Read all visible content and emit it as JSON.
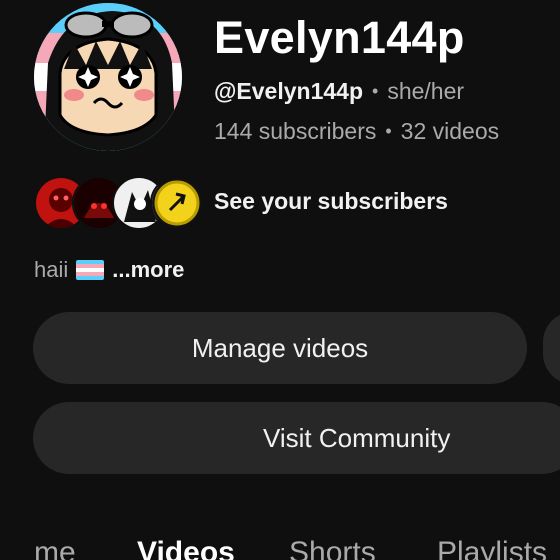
{
  "channel": {
    "name": "Evelyn144p",
    "handle": "@Evelyn144p",
    "pronouns": "she/her",
    "subscribers": "144 subscribers",
    "videos": "32 videos",
    "separator": "•"
  },
  "subscribers_row": {
    "label": "See your subscribers",
    "avatar_colors": [
      "#c0120f",
      "#1a0000",
      "#f0f0f0",
      "#f2d21a"
    ]
  },
  "description": {
    "text": "haii",
    "flag_icon": "trans-flag-icon",
    "more_label": "...more"
  },
  "buttons": {
    "manage_videos": "Manage videos",
    "visit_community": "Visit Community"
  },
  "tabs": [
    {
      "label": "Home",
      "visible_label": "me"
    },
    {
      "label": "Videos",
      "visible_label": "Videos",
      "active": true
    },
    {
      "label": "Shorts",
      "visible_label": "Shorts"
    },
    {
      "label": "Playlists",
      "visible_label": "Playlists"
    }
  ],
  "colors": {
    "background": "#0f0f0f",
    "button_bg": "#272727",
    "text_primary": "#f1f1f1",
    "text_secondary": "#aaaaaa",
    "trans_blue": "#5bcefa",
    "trans_pink": "#f5a9b8"
  }
}
